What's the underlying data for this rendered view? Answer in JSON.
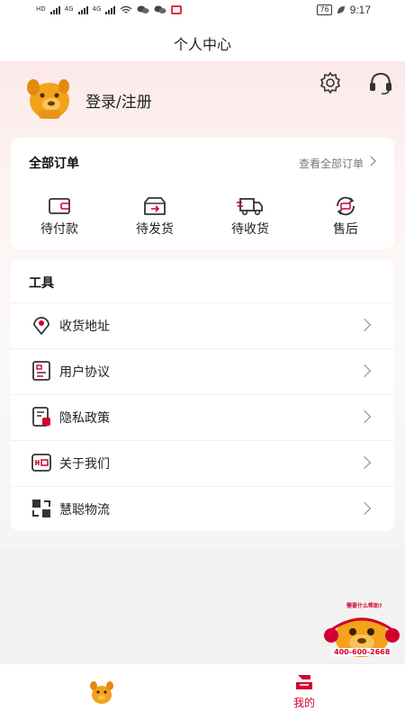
{
  "status_bar": {
    "network_labels": [
      "HD",
      "4G",
      "4G"
    ],
    "battery": "76",
    "time": "9:17"
  },
  "header": {
    "title": "个人中心"
  },
  "profile": {
    "login_label": "登录/注册"
  },
  "orders": {
    "title": "全部订单",
    "view_all": "查看全部订单",
    "items": [
      {
        "label": "待付款",
        "icon": "wallet-icon"
      },
      {
        "label": "待发货",
        "icon": "box-icon"
      },
      {
        "label": "待收货",
        "icon": "truck-icon"
      },
      {
        "label": "售后",
        "icon": "after-sale-icon"
      }
    ]
  },
  "tools": {
    "title": "工具",
    "items": [
      {
        "label": "收货地址",
        "icon": "location-icon"
      },
      {
        "label": "用户协议",
        "icon": "agreement-icon"
      },
      {
        "label": "隐私政策",
        "icon": "privacy-icon"
      },
      {
        "label": "关于我们",
        "icon": "about-icon"
      },
      {
        "label": "慧聪物流",
        "icon": "logistics-icon"
      }
    ]
  },
  "mascot": {
    "bubble": "需要什么帮助?",
    "phone": "400-600-2668"
  },
  "tab_bar": {
    "mine_label": "我的"
  },
  "colors": {
    "accent": "#d2002e",
    "mascot_orange": "#f2a21b"
  }
}
